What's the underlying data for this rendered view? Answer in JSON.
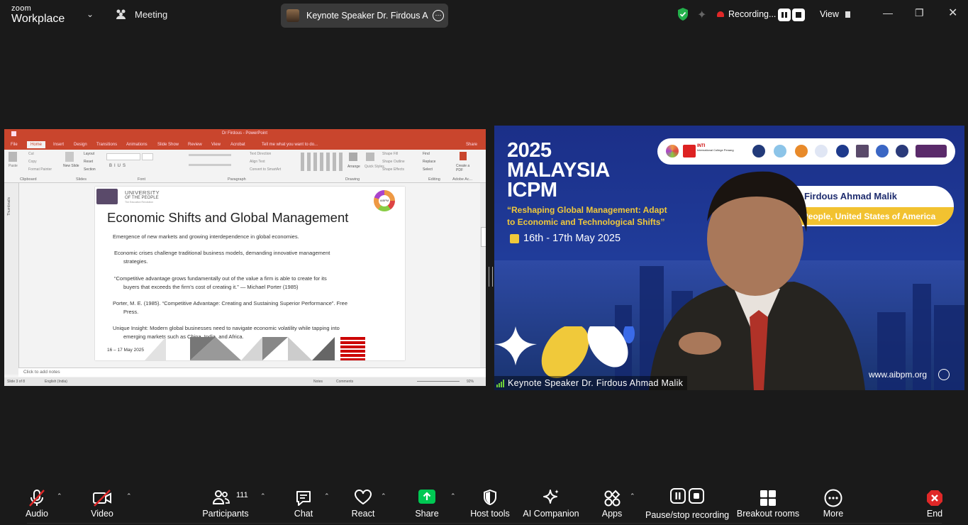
{
  "app": {
    "brand_line1": "zoom",
    "brand_line2": "Workplace",
    "meeting_label": "Meeting",
    "speaker_pill": "Keynote Speaker Dr. Firdous Ahm",
    "recording_label": "Recording...",
    "view_label": "View"
  },
  "ppt": {
    "window_title": "Dr Firdous - PowerPoint",
    "tabs": [
      "File",
      "Home",
      "Insert",
      "Design",
      "Transitions",
      "Animations",
      "Slide Show",
      "Review",
      "View",
      "Acrobat"
    ],
    "tell_me": "Tell me what you want to do...",
    "share": "Share",
    "ribbon_groups": [
      "Clipboard",
      "Slides",
      "Font",
      "Paragraph",
      "Drawing",
      "Editing",
      "Adobe Ac..."
    ],
    "ribbon_items": {
      "paste": "Paste",
      "cut": "Cut",
      "copy": "Copy",
      "format_painter": "Format Painter",
      "layout": "Layout",
      "reset": "Reset",
      "section": "Section",
      "new_slide": "New Slide",
      "text_direction": "Text Direction",
      "align_text": "Align Text",
      "convert_smartart": "Convert to SmartArt",
      "arrange": "Arrange",
      "quick_styles": "Quick Styles",
      "shape_fill": "Shape Fill",
      "shape_outline": "Shape Outline",
      "shape_effects": "Shape Effects",
      "find": "Find",
      "replace": "Replace",
      "select": "Select",
      "create_pdf": "Create a PDF"
    },
    "thumbnails_label": "Thumbnails",
    "notes_placeholder": "Click to add notes",
    "status": {
      "slide": "Slide 3 of 8",
      "language": "English (India)",
      "notes": "Notes",
      "comments": "Comments",
      "zoom": "92%"
    },
    "slide": {
      "uni_line1": "UNIVERSITY",
      "uni_line2": "OF THE PEOPLE",
      "uni_line3": "The Education Revolution",
      "ring_label": "AIBPM",
      "title": "Economic Shifts and Global Management",
      "p1": "Emergence of new markets and growing interdependence in global economies.",
      "p2a": "Economic crises challenge traditional business models, demanding innovative management",
      "p2b": "strategies.",
      "p3a": "“Competitive advantage grows fundamentally out of the value a firm is able to create for its",
      "p3b": "buyers that exceeds the firm's cost of creating it.” — Michael Porter (1985)",
      "p4a": "Porter, M. E. (1985). “Competitive Advantage: Creating and Sustaining Superior Performance”. Free",
      "p4b": "Press.",
      "p5a": "Unique Insight: Modern global businesses need to navigate economic volatility while tapping into",
      "p5b": "emerging markets such as China, India, and Africa.",
      "date": "16 – 17 May 2025"
    }
  },
  "video": {
    "year": "2025",
    "line2": "MALAYSIA",
    "line3": "ICPM",
    "tagline1": "“Reshaping Global Management: Adapt",
    "tagline2": "to Economic and Technological Shifts”",
    "date": "16th - 17th May 2025",
    "logo_inti": "INTI",
    "logo_inti_sub": "International College Penang",
    "speaker_name": "Dr. Firdous Ahmad Malik",
    "affiliation": "y of People, United States of America",
    "url": "www.aibpm.org",
    "participant_label": "Keynote Speaker Dr. Firdous Ahmad Malik"
  },
  "toolbar": {
    "audio": "Audio",
    "video": "Video",
    "participants": "Participants",
    "participants_count": "111",
    "chat": "Chat",
    "react": "React",
    "share": "Share",
    "host_tools": "Host tools",
    "ai_companion": "AI Companion",
    "apps": "Apps",
    "pause_stop": "Pause/stop recording",
    "breakout": "Breakout rooms",
    "more": "More",
    "end": "End"
  },
  "colors": {
    "zoom_blue": "#2d8cff",
    "share_green": "#00c853",
    "end_red": "#e02828",
    "ppt_red": "#c9452d",
    "banner_gold": "#f2c230"
  }
}
